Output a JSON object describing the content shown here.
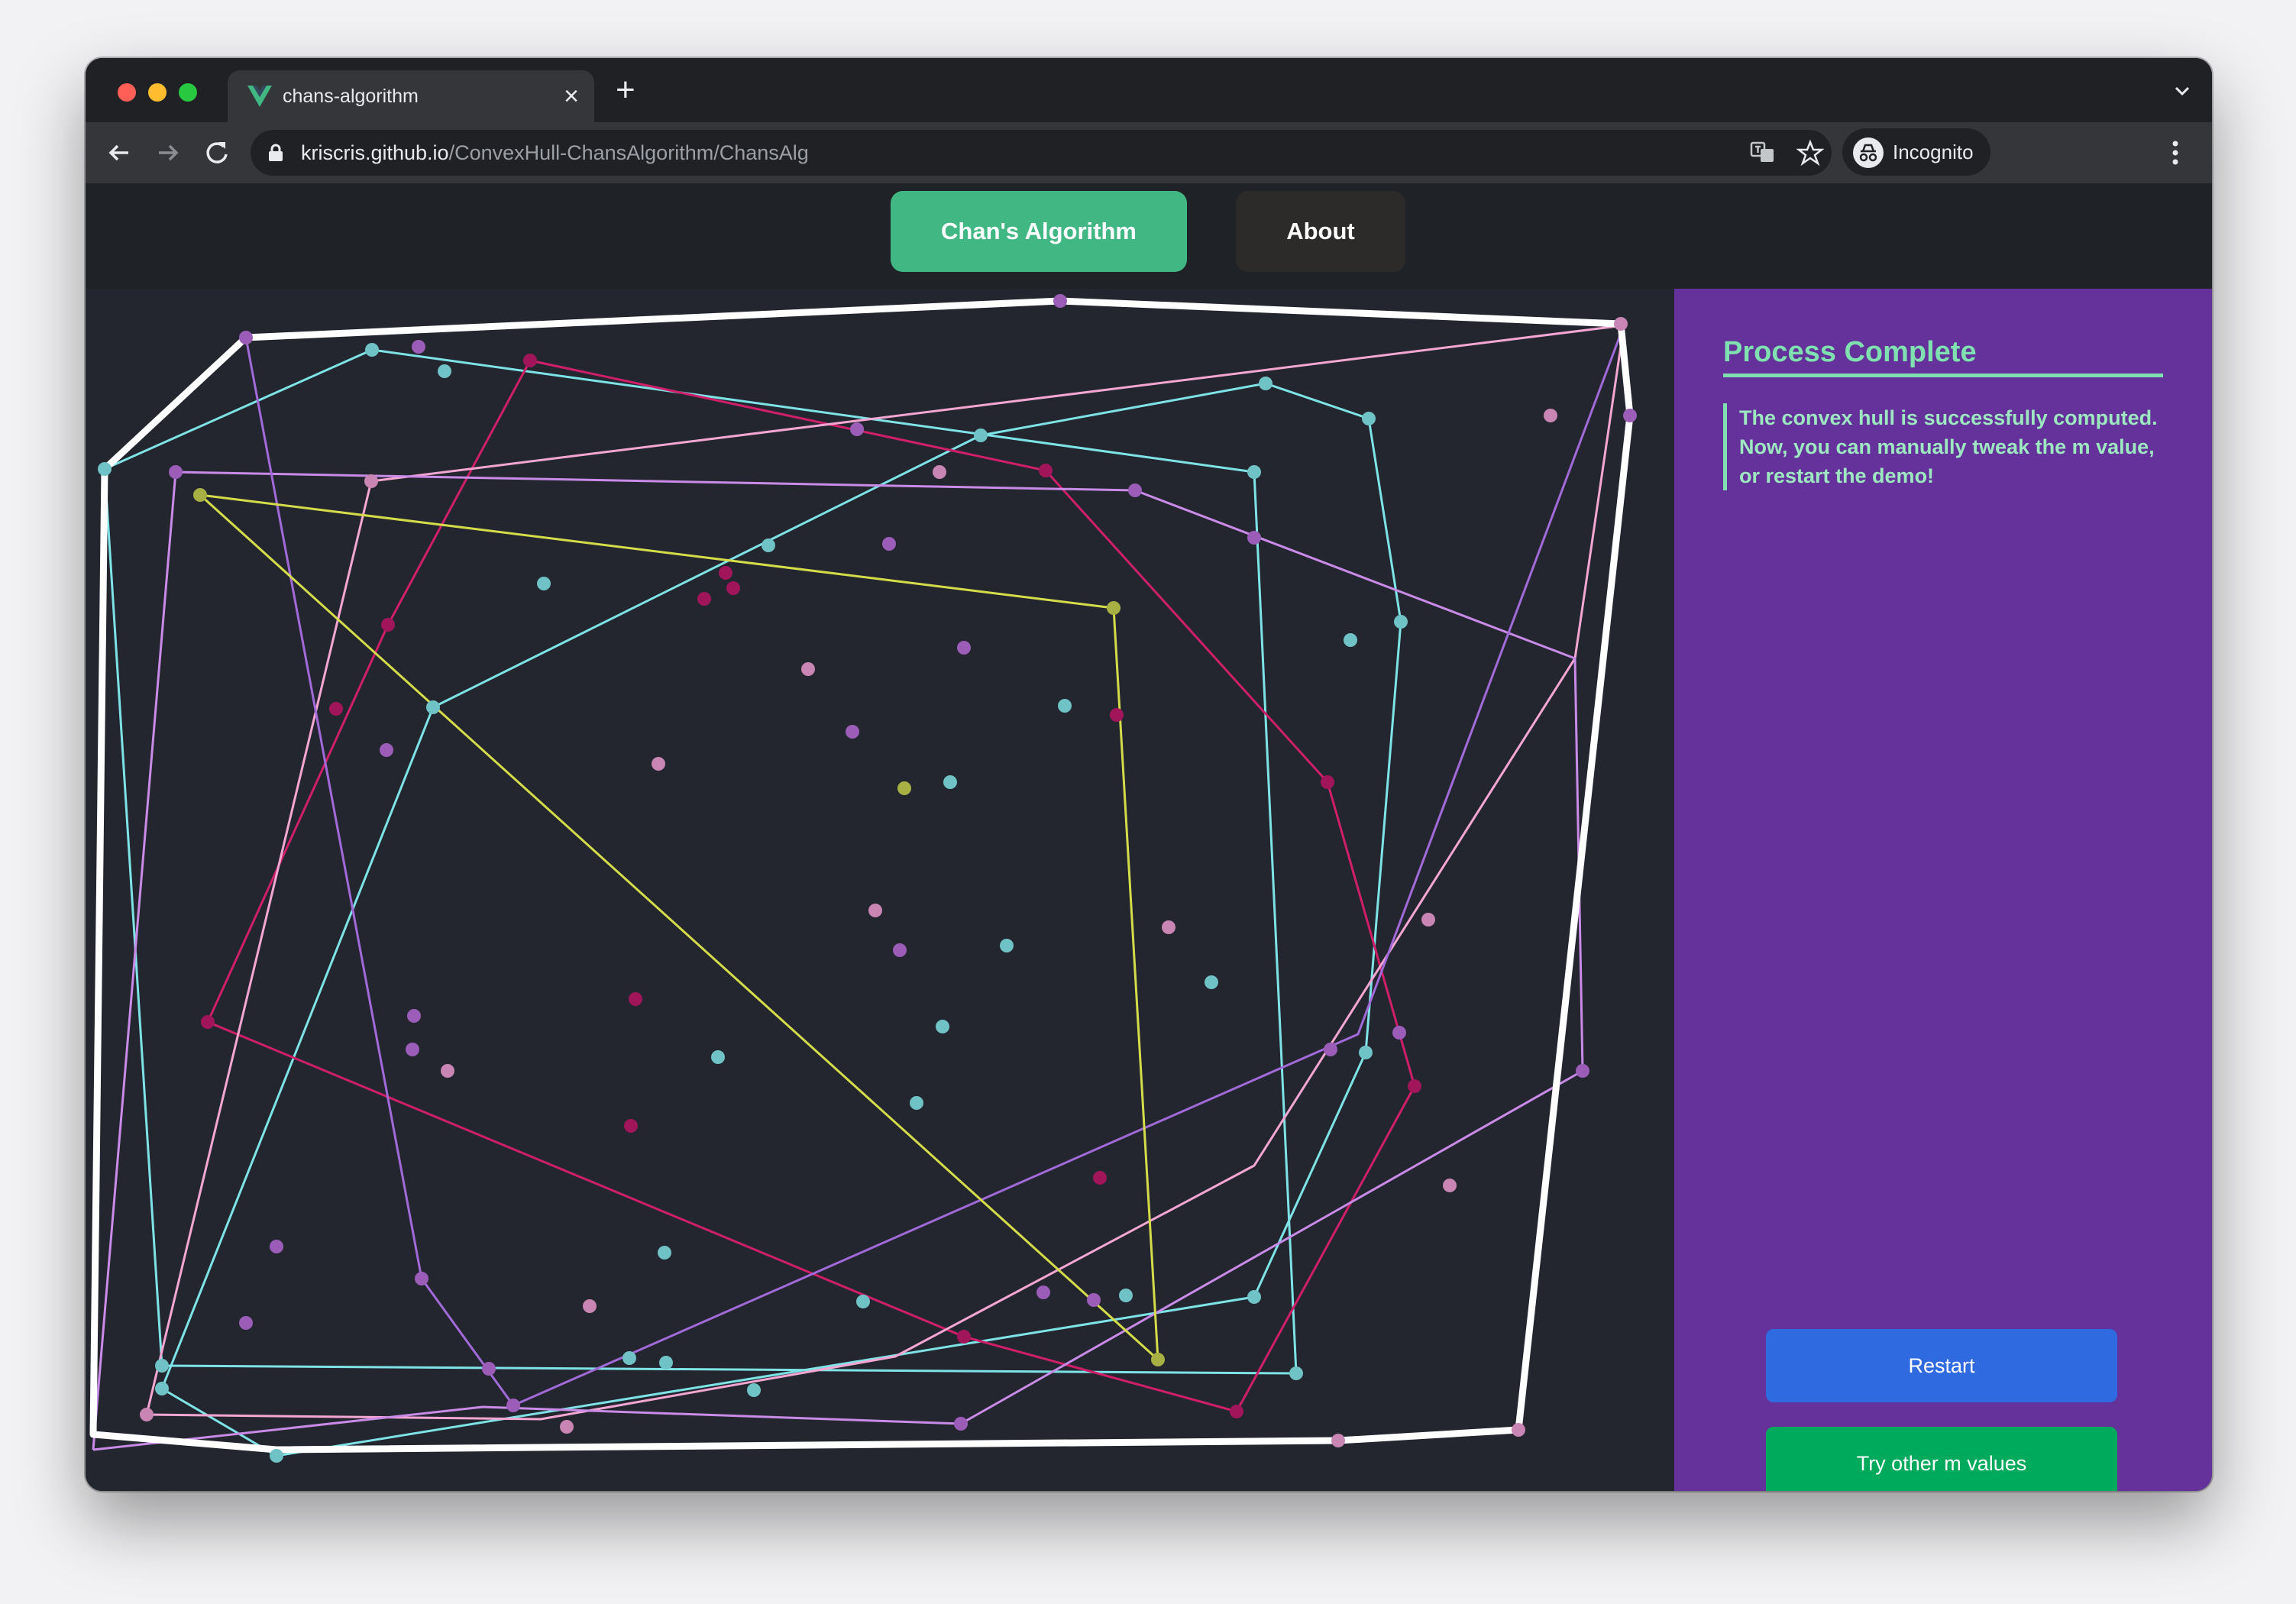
{
  "browser": {
    "tab_title": "chans-algorithm",
    "url_host": "kriscris.github.io",
    "url_path": "/ConvexHull-ChansAlgorithm/ChansAlg",
    "incognito_label": "Incognito"
  },
  "app_nav": {
    "chans_label": "Chan's Algorithm",
    "about_label": "About"
  },
  "sidebar": {
    "title": "Process Complete",
    "message": "The convex hull is successfully computed. Now, you can manually tweak the m value, or restart the demo!",
    "restart_label": "Restart",
    "try_label": "Try other m values"
  },
  "colors": {
    "hull": "#ffffff",
    "cyan": "#7ee3e6",
    "magenta": "#cf1f6a",
    "pink": "#f5a6d3",
    "violet": "#c98ae8",
    "purple": "#a26ad8",
    "yellow": "#d5dc4a"
  }
}
